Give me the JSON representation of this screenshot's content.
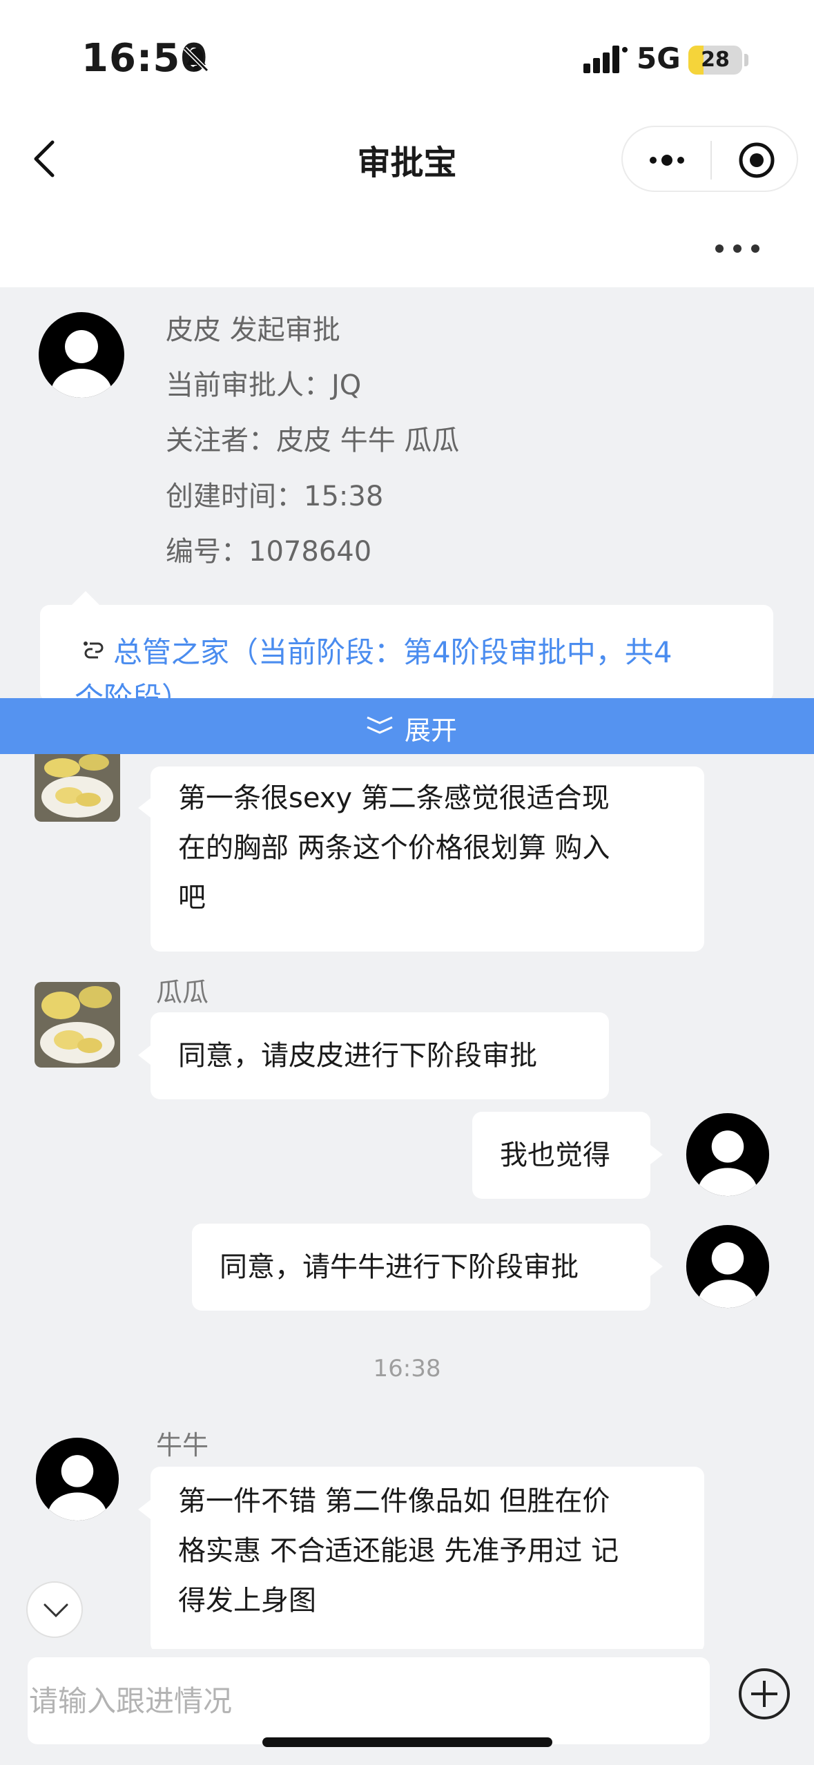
{
  "status_bar": {
    "time": "16:50",
    "network": "5G",
    "battery": "28",
    "battery_level": 0.28
  },
  "nav": {
    "title": "审批宝"
  },
  "request": {
    "initiated": "皮皮 发起审批",
    "approver": "当前审批人：JQ",
    "followers": "关注者：皮皮  牛牛  瓜瓜",
    "created": "创建时间：15:38",
    "number": "编号：1078640"
  },
  "stage": {
    "line1": "总管之家（当前阶段：第4阶段审批中，共4",
    "line2": "个阶段）"
  },
  "expand_label": "展开",
  "messages": {
    "m1": {
      "lines": [
        "第一条很sexy 第二条感觉很适合现",
        "在的胸部 两条这个价格很划算 购入",
        "吧"
      ]
    },
    "m2": {
      "sender": "瓜瓜",
      "text": "同意，请皮皮进行下阶段审批"
    },
    "m3": {
      "text": "我也觉得"
    },
    "m4": {
      "text": "同意，请牛牛进行下阶段审批"
    },
    "timestamp": "16:38",
    "m5": {
      "sender": "牛牛",
      "lines": [
        "第一件不错 第二件像品如 但胜在价",
        "格实惠 不合适还能退 先准予用过 记",
        "得发上身图"
      ]
    }
  },
  "input": {
    "placeholder": "请输入跟进情况"
  }
}
